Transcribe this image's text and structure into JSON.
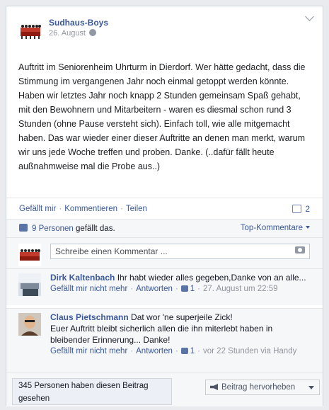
{
  "post": {
    "page_name": "Sudhaus-Boys",
    "date": "26. August",
    "text": "Auftritt im Seniorenheim Uhrturm in Dierdorf. Wer hätte gedacht, dass die Stimmung im vergangenen Jahr noch einmal getoppt werden könnte. Haben wir letztes Jahr noch knapp 2 Stunden gemeinsam Spaß gehabt, mit den Bewohnern und Mitarbeitern - waren es diesmal schon rund 3 Stunden (ohne Pause versteht sich). Einfach toll, wie alle mitgemacht haben. Das war wieder einer dieser Auftritte an denen man merkt, warum wir uns jede Woche treffen und proben. Danke. (..dafür fällt heute außnahmweise mal die Probe aus..)"
  },
  "actions": {
    "like": "Gefällt mir",
    "comment": "Kommentieren",
    "share": "Teilen",
    "share_count": "2"
  },
  "likes": {
    "count_link": "9 Personen",
    "suffix": "gefällt das.",
    "top_comments": "Top-Kommentare"
  },
  "comment_box": {
    "placeholder": "Schreibe einen Kommentar ..."
  },
  "comments": [
    {
      "author": "Dirk Kaltenbach",
      "text": "Ihr habt wieder alles gegeben,Danke von an alle...",
      "unlike": "Gefällt mir nicht mehr",
      "reply": "Antworten",
      "likes": "1",
      "time": "27. August um 22:59",
      "via": ""
    },
    {
      "author": "Claus Pietschmann",
      "text": "Dat wor 'ne superjeile Zick!\nEuer Auftritt bleibt sicherlich allen die ihn miterlebt haben in bleibender Erinnerung... Danke!",
      "unlike": "Gefällt mir nicht mehr",
      "reply": "Antworten",
      "likes": "1",
      "time": "vor 22 Stunden via",
      "via": "Handy"
    }
  ],
  "footer": {
    "seen": "345 Personen haben diesen Beitrag gesehen",
    "promote": "Beitrag hervorheben"
  },
  "icons": {
    "globe": "globe-icon",
    "share": "share-icon",
    "thumb": "thumbs-up-icon",
    "camera": "camera-icon",
    "megaphone": "megaphone-icon"
  },
  "colors": {
    "link": "#3b5998",
    "meta": "#90949c",
    "background": "#e9ebee"
  }
}
